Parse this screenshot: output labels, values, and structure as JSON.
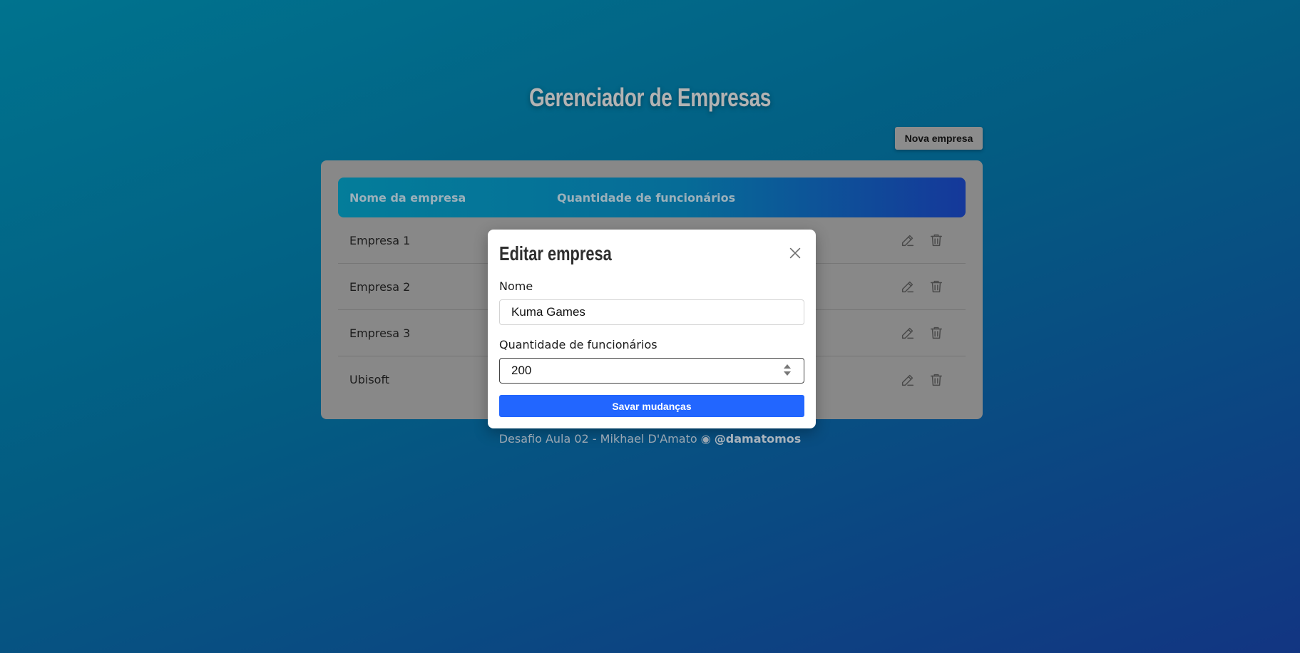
{
  "header": {
    "title": "Gerenciador de Empresas"
  },
  "toolbar": {
    "new_company_label": "Nova empresa"
  },
  "table": {
    "columns": [
      "Nome da empresa",
      "Quantidade de funcionários"
    ],
    "rows": [
      {
        "name": "Empresa 1"
      },
      {
        "name": "Empresa 2"
      },
      {
        "name": "Empresa 3"
      },
      {
        "name": "Ubisoft"
      }
    ]
  },
  "modal": {
    "title": "Editar empresa",
    "name_label": "Nome",
    "name_value": "Kuma Games",
    "employees_label": "Quantidade de funcionários",
    "employees_value": "200",
    "save_label": "Savar mudanças"
  },
  "footer": {
    "text": "Desafio Aula 02 - Mikhael D'Amato ◉ ",
    "handle": "@damatomos"
  },
  "icons": {
    "edit": "pencil-icon",
    "delete": "trash-icon",
    "close": "close-icon"
  },
  "colors": {
    "accent": "#2266ff",
    "card": "#888888",
    "background_start": "#00738e",
    "background_end": "#123582"
  }
}
